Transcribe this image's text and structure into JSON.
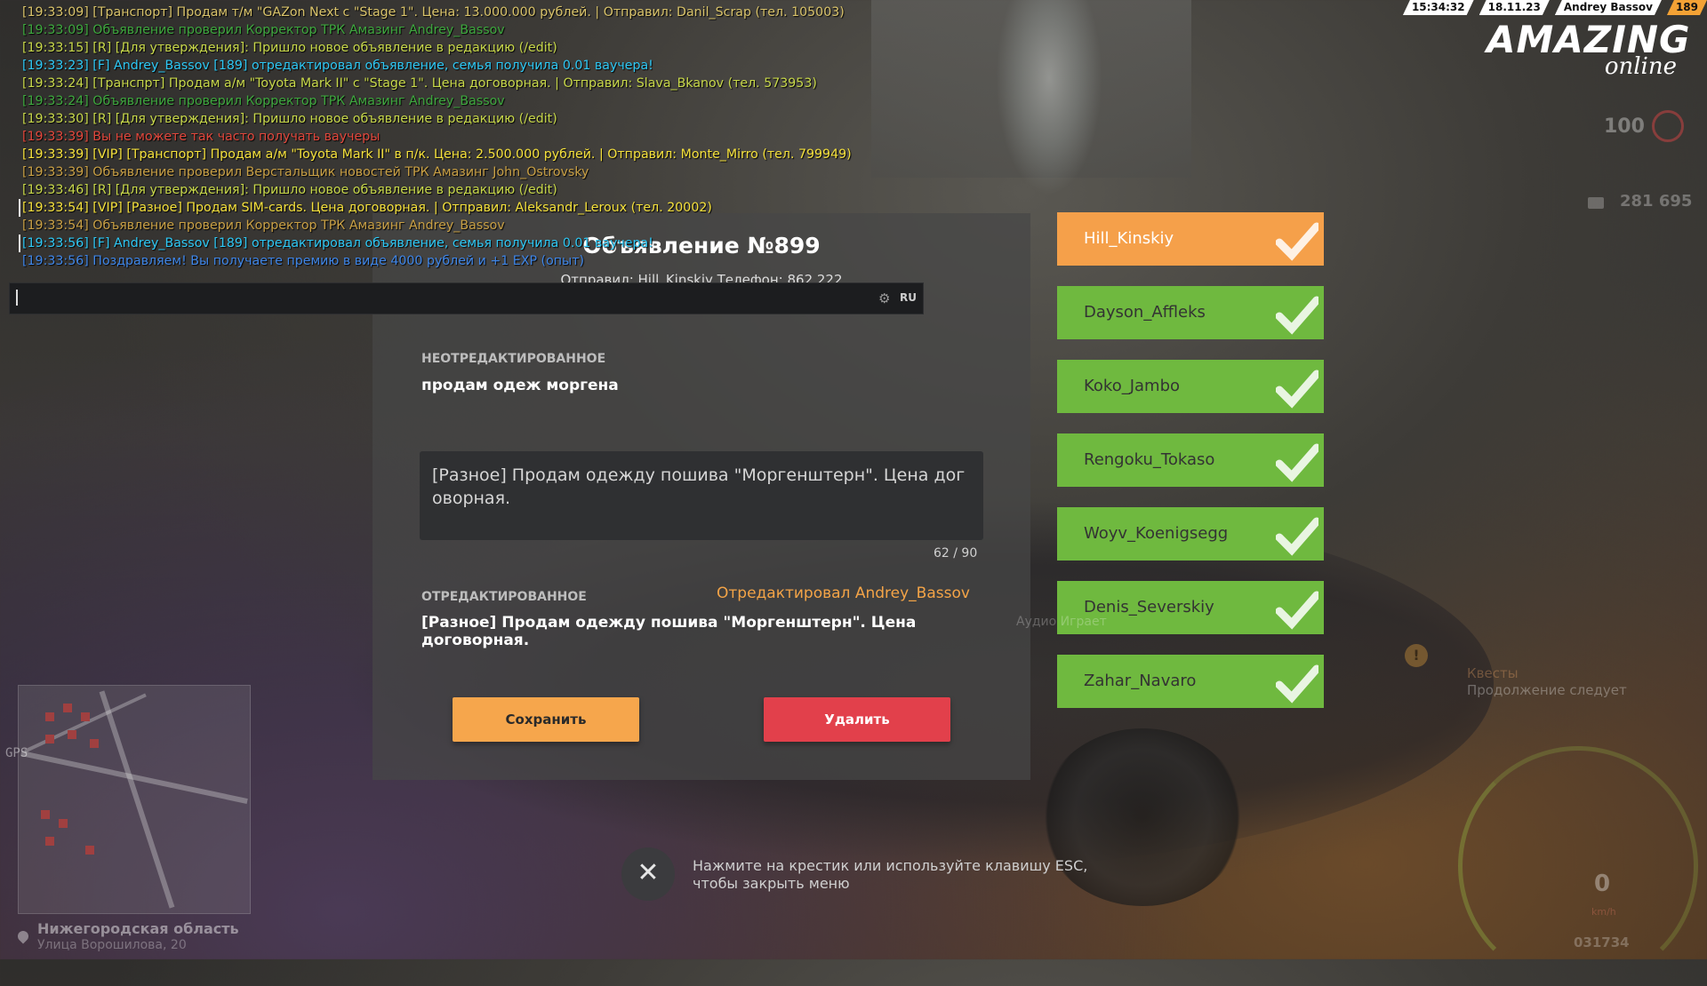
{
  "chat": {
    "lines": [
      {
        "text": "[19:33:09] [Транспорт] Продам т/м \"GAZon Next с \"Stage 1\". Цена: 13.000.000 рублей. | Отправил: Danil_Scrap (тел. 105003)",
        "color": "#d9c36a"
      },
      {
        "text": "[19:33:09] Объявление проверил Корректор ТРК Амазинг Andrey_Bassov",
        "color": "#3ea83e"
      },
      {
        "text": "[19:33:15] [R] [Для утверждения]: Пришло новое объявление в редакцию (/edit)",
        "color": "#c8d84a"
      },
      {
        "text": "[19:33:23] [F] Andrey_Bassov [189] отредактировал объявление, семья получила 0.01 ваучера!",
        "color": "#2ec8f5"
      },
      {
        "text": "[19:33:24] [Транспрт] Продам а/м \"Toyota Mark II\" с \"Stage 1\". Цена договорная. | Отправил: Slava_Bkanov (тел. 573953)",
        "color": "#c8d84a"
      },
      {
        "text": "[19:33:24] Объявление проверил Корректор ТРК Амазинг Andrey_Bassov",
        "color": "#3ea83e"
      },
      {
        "text": "[19:33:30] [R] [Для утверждения]: Пришло новое объявление в редакцию (/edit)",
        "color": "#c8d84a"
      },
      {
        "text": "[19:33:39] Вы не можете так часто получать ваучеры",
        "color": "#e2473c"
      },
      {
        "text": "[19:33:39] [VIP] [Транспорт] Продам а/м \"Toyota Mark II\" в п/к. Цена: 2.500.000 рублей. | Отправил: Monte_Mirro (тел. 799949)",
        "color": "#f5e13c"
      },
      {
        "text": "[19:33:39] Объявление проверил Верстальщик новостей ТРК Амазинг John_Ostrovsky",
        "color": "#c9a045"
      },
      {
        "text": "[19:33:46] [R] [Для утверждения]: Пришло новое объявление в редакцию (/edit)",
        "color": "#c8d84a"
      },
      {
        "text": "[19:33:54] [VIP] [Разное] Продам SIM-cards. Цена договорная. | Отправил: Aleksandr_Leroux (тел. 20002)",
        "color": "#f5e13c"
      },
      {
        "text": "[19:33:54] Объявление проверил Корректор ТРК Амазинг Andrey_Bassov",
        "color": "#c9a045"
      },
      {
        "text": "[19:33:56] [F] Andrey_Bassov [189] отредактировал объявление, семья получила 0.01 ваучера!",
        "color": "#2ec8f5"
      },
      {
        "text": "[19:33:56] Поздравляем! Вы получаете премию в виде 4000 рублей и +1 EXP (опыт)",
        "color": "#3f86e8"
      }
    ],
    "input_lang": "RU"
  },
  "hud": {
    "time": "15:34:32",
    "date": "18.11.23",
    "player": "Andrey Bassov",
    "id": "189",
    "logo_main": "AMAZING",
    "logo_sub": "online",
    "health": "100",
    "money": "281 695"
  },
  "dialog": {
    "title": "Объявление №899",
    "sender": "Отправил: Hill_Kinskiy Телефон: 862 222",
    "unedited_label": "НЕОТРЕДАКТИРОВАННОЕ",
    "unedited_text": "продам одеж моргена",
    "edit_value": "[Разное] Продам одежду пошива \"Моргенштерн\". Цена договорная.",
    "counter": "62 / 90",
    "edited_label": "ОТРЕДАКТИРОВАННОЕ",
    "edited_by": "Отредактировал Andrey_Bassov",
    "edited_text": "[Разное] Продам одежду пошива \"Моргенштерн\". Цена договорная.",
    "save_label": "Сохранить",
    "delete_label": "Удалить"
  },
  "close_hint": "Нажмите на крестик или используйте клавишу ESC, чтобы закрыть меню",
  "players": [
    {
      "name": "Hill_Kinskiy",
      "state": "orange"
    },
    {
      "name": "Dayson_Affleks",
      "state": "green"
    },
    {
      "name": "Koko_Jambo",
      "state": "green"
    },
    {
      "name": "Rengoku_Tokaso",
      "state": "green"
    },
    {
      "name": "Woyv_Koenigsegg",
      "state": "green"
    },
    {
      "name": "Denis_Severskiy",
      "state": "green"
    },
    {
      "name": "Zahar_Navaro",
      "state": "green"
    }
  ],
  "map": {
    "gps": "GPS",
    "region": "Нижегородская область",
    "street": "Улица Ворошилова, 20"
  },
  "quest": {
    "title": "Квесты",
    "subtitle": "Продолжение следует"
  },
  "audio_text": "Аудио Играет",
  "vehicle": {
    "speed": "0",
    "unit": "km/h",
    "odometer": "031734"
  }
}
